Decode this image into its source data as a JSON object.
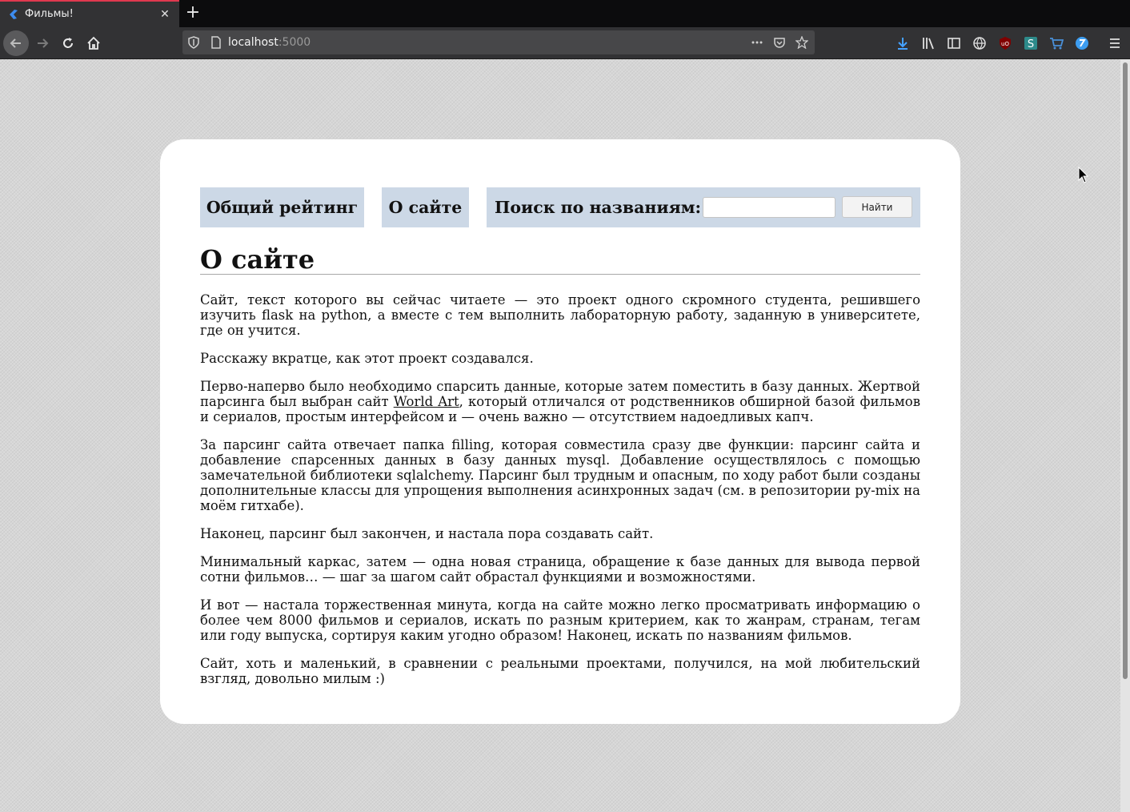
{
  "browser": {
    "tab_title": "Фильмы!",
    "url_host": "localhost",
    "url_port": ":5000"
  },
  "nav": {
    "rating_link": "Общий рейтинг",
    "about_link": "О сайте",
    "search_label": "Поиск по названиям:",
    "search_value": "",
    "search_button": "Найти"
  },
  "page": {
    "title": "О сайте",
    "p1": "Сайт, текст которого вы сейчас читаете — это проект одного скромного студента, решившего изучить flask на python, а вместе с тем выполнить лабораторную работу, заданную в университете, где он учит­ся.",
    "p2": "Расскажу вкратце, как этот проект создавался.",
    "p3_before": "Перво-наперво было необходимо спарсить данные, которые затем поместить в базу данных. Жертвой парсинга был выбран сайт ",
    "p3_link": "World Art",
    "p3_after": ", который отличался от родственников обширной базой фильмов и сериалов, простым интерфейсом и — очень важно — отсутствием надоедливых капч.",
    "p4": "За парсинг сайта отвечает папка filling, которая совместила сразу две функции: парсинг сайта и добав­ление спарсенных данных в базу данных mysql. Добавление осуществлялось с помощью замечательной библиотеки sqlalchemy. Парсинг был трудным и опасным, по ходу работ были созданы дополнительные классы для упрощения выполнения асинхронных задач (см. в репозитории py-mix на моём гитхабе).",
    "p5": "Наконец, парсинг был закончен, и настала пора создавать сайт.",
    "p6": "Минимальный каркас, затем — одна новая страница, обращение к базе данных для вывода первой сотни фильмов… — шаг за шагом сайт обрастал функциями и возможностями.",
    "p7": "И вот — настала торжественная минута, когда на сайте можно легко просматривать информацию о бо­лее чем 8000 фильмов и сериалов, искать по разным критерием, как то жанрам, странам, тегам или го­ду выпуска, сортируя каким угодно образом! Наконец, искать по названиям фильмов.",
    "p8": "Сайт, хоть и маленький, в сравнении с реальными проектами, получился, на мой любительский взгляд, довольно милым :)"
  },
  "colors": {
    "nav_box": "#ccd8e6",
    "card": "#ffffff",
    "background": "#d6d6d6",
    "tab_accent": "#e0394f"
  },
  "icons": [
    "favicon-icon",
    "close-icon",
    "plus-icon",
    "back-icon",
    "forward-icon",
    "reload-icon",
    "home-icon",
    "shield-icon",
    "page-icon",
    "more-icon",
    "pocket-icon",
    "star-icon",
    "download-icon",
    "library-icon",
    "sidebar-icon",
    "globe-icon",
    "ublock-icon",
    "s-extension-icon",
    "cart-icon",
    "extension-icon",
    "menu-icon",
    "cursor-icon"
  ]
}
